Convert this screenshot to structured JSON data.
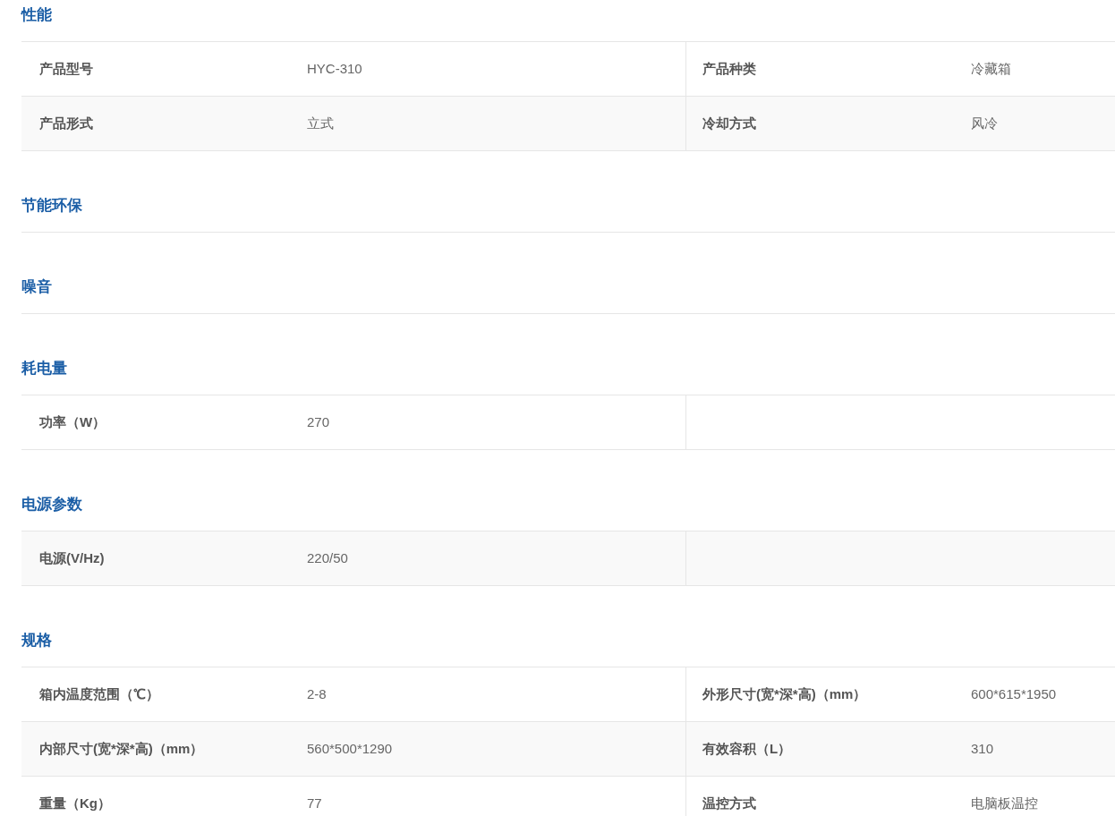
{
  "sections": [
    {
      "title": "性能",
      "rows": [
        {
          "cells": [
            {
              "label": "产品型号",
              "value": "HYC-310"
            },
            {
              "label": "产品种类",
              "value": "冷藏箱"
            }
          ]
        },
        {
          "cells": [
            {
              "label": "产品形式",
              "value": "立式"
            },
            {
              "label": "冷却方式",
              "value": "风冷"
            }
          ]
        }
      ]
    },
    {
      "title": "节能环保"
    },
    {
      "title": "噪音"
    },
    {
      "title": "耗电量",
      "rows": [
        {
          "cells": [
            {
              "label": "功率（W）",
              "value": "270"
            }
          ]
        }
      ]
    },
    {
      "title": "电源参数",
      "rows": [
        {
          "cells": [
            {
              "label": "电源(V/Hz)",
              "value": "220/50"
            }
          ]
        }
      ]
    },
    {
      "title": "规格",
      "rows": [
        {
          "cells": [
            {
              "label": "箱内温度范围（℃）",
              "value": "2-8"
            },
            {
              "label": "外形尺寸(宽*深*高)（mm）",
              "value": "600*615*1950"
            }
          ]
        },
        {
          "cells": [
            {
              "label": "内部尺寸(宽*深*高)（mm）",
              "value": "560*500*1290"
            },
            {
              "label": "有效容积（L）",
              "value": "310"
            }
          ]
        },
        {
          "cells": [
            {
              "label": "重量（Kg）",
              "value": "77"
            },
            {
              "label": "温控方式",
              "value": "电脑板温控"
            }
          ]
        }
      ]
    }
  ]
}
